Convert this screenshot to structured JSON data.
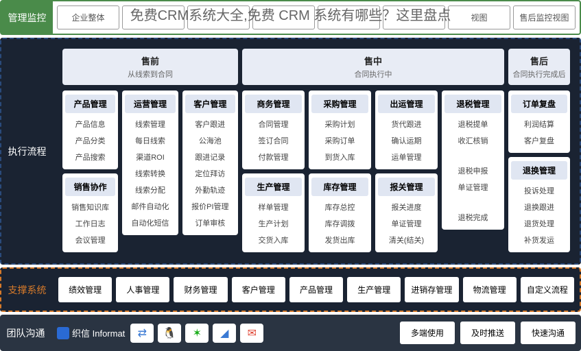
{
  "banner": "免费CRM系统大全,免费 CRM 系统有哪些？这里盘点",
  "sections": {
    "management": {
      "label": "管理监控",
      "items": [
        "企业整体",
        "",
        "",
        "",
        "",
        "",
        "视图",
        "售后监控视图"
      ]
    },
    "execution": {
      "label": "执行流程",
      "phases": {
        "pre": {
          "title": "售前",
          "sub": "从线索到合同"
        },
        "mid": {
          "title": "售中",
          "sub": "合同执行中"
        },
        "post": {
          "title": "售后",
          "sub": "合同执行完成后"
        }
      },
      "pre_cols": [
        {
          "blocks": [
            {
              "title": "产品管理",
              "items": [
                "产品信息",
                "产品分类",
                "产品搜索"
              ]
            },
            {
              "title": "销售协作",
              "items": [
                "销售知识库",
                "工作日志",
                "会议管理"
              ]
            }
          ]
        },
        {
          "blocks": [
            {
              "title": "运营管理",
              "items": [
                "线索管理",
                "每日线索",
                "渠道ROI",
                "线索转换",
                "线索分配",
                "邮件自动化",
                "自动化短信"
              ]
            }
          ]
        },
        {
          "blocks": [
            {
              "title": "客户管理",
              "items": [
                "客户跟进",
                "公海池",
                "跟进记录",
                "定位拜访",
                "外勤轨迹",
                "报价PI管理",
                "订单审核"
              ]
            }
          ]
        }
      ],
      "mid_cols": [
        {
          "blocks": [
            {
              "title": "商务管理",
              "items": [
                "合同管理",
                "签订合同",
                "付款管理"
              ]
            },
            {
              "title": "生产管理",
              "items": [
                "样单管理",
                "生产计划",
                "交货入库"
              ]
            }
          ]
        },
        {
          "blocks": [
            {
              "title": "采购管理",
              "items": [
                "采购计划",
                "采购订单",
                "到货入库"
              ]
            },
            {
              "title": "库存管理",
              "items": [
                "库存总控",
                "库存调拨",
                "发货出库"
              ]
            }
          ]
        },
        {
          "blocks": [
            {
              "title": "出运管理",
              "items": [
                "货代跟进",
                "确认运期",
                "运单管理"
              ]
            },
            {
              "title": "报关管理",
              "items": [
                "报关进度",
                "单证管理",
                "清关(结关)"
              ]
            }
          ]
        },
        {
          "blocks": [
            {
              "title": "退税管理",
              "items": [
                "退税提单",
                "收汇核销",
                "",
                "退税申报",
                "单证管理",
                "",
                "退税完成"
              ]
            }
          ]
        }
      ],
      "post_cols": [
        {
          "blocks": [
            {
              "title": "订单复盘",
              "items": [
                "利润结算",
                "客户复盘"
              ]
            },
            {
              "title": "退换管理",
              "items": [
                "投诉处理",
                "退换跟进",
                "退货处理",
                "补货发运"
              ]
            }
          ]
        }
      ]
    },
    "support": {
      "label": "支撑系统",
      "items": [
        "绩效管理",
        "人事管理",
        "财务管理",
        "客户管理",
        "产品管理",
        "生产管理",
        "进销存管理",
        "物流管理",
        "自定义流程"
      ]
    },
    "communication": {
      "label": "团队沟通",
      "brand": "织信 Informat",
      "icons": [
        "exchange",
        "qq",
        "wechat",
        "dingtalk",
        "mail"
      ],
      "buttons": [
        "多端使用",
        "及时推送",
        "快速沟通"
      ]
    }
  },
  "icon_colors": {
    "exchange": "#3a7ad4",
    "qq": "#2aa0e0",
    "wechat": "#1aad19",
    "dingtalk": "#3a7ad4",
    "mail": "#e04a3a"
  }
}
